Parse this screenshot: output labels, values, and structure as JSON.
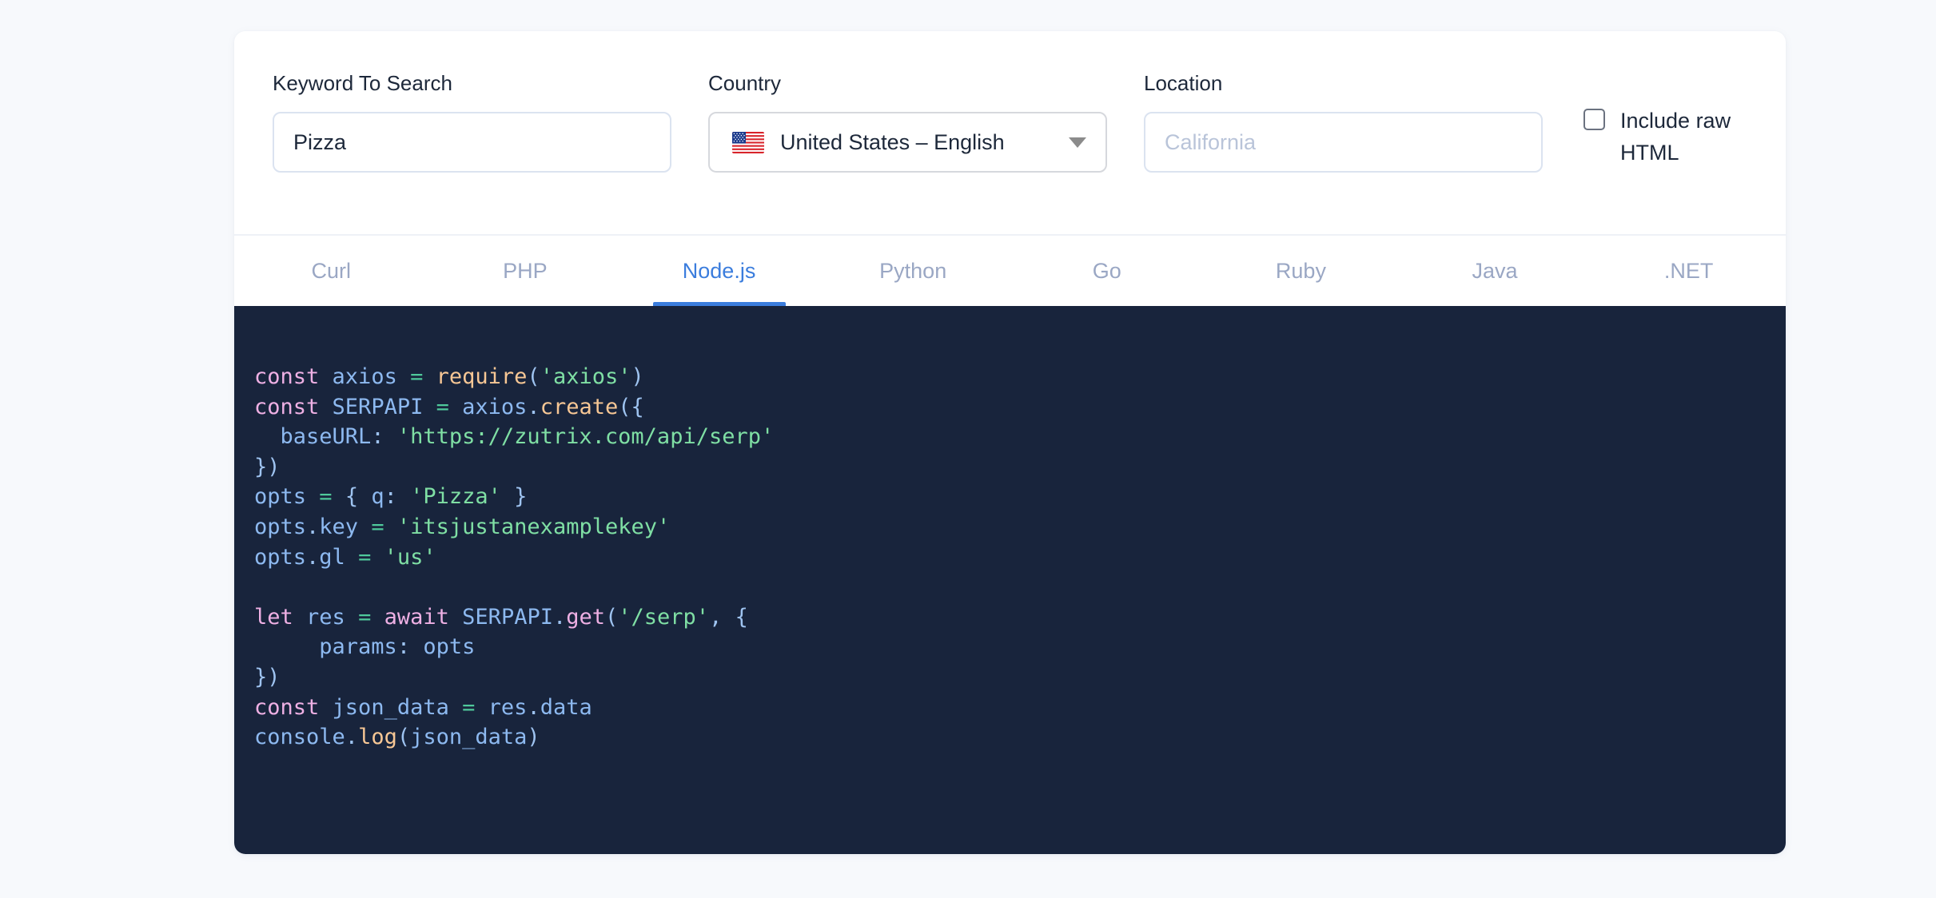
{
  "form": {
    "keyword": {
      "label": "Keyword To Search",
      "value": "Pizza",
      "placeholder": ""
    },
    "country": {
      "label": "Country",
      "value": "United States – English",
      "flag_icon": "us-flag-icon",
      "caret_icon": "chevron-down-icon"
    },
    "location": {
      "label": "Location",
      "value": "",
      "placeholder": "California"
    },
    "raw_html": {
      "label": "Include raw HTML",
      "checked": false
    }
  },
  "tabs": {
    "active": "Node.js",
    "items": [
      {
        "label": "Curl"
      },
      {
        "label": "PHP"
      },
      {
        "label": "Node.js"
      },
      {
        "label": "Python"
      },
      {
        "label": "Go"
      },
      {
        "label": "Ruby"
      },
      {
        "label": "Java"
      },
      {
        "label": ".NET"
      }
    ]
  },
  "code": {
    "language": "Node.js",
    "lines": [
      [
        {
          "t": "const",
          "c": "kw"
        },
        {
          "t": " ",
          "c": "pun"
        },
        {
          "t": "axios",
          "c": "var"
        },
        {
          "t": " ",
          "c": "pun"
        },
        {
          "t": "=",
          "c": "op"
        },
        {
          "t": " ",
          "c": "pun"
        },
        {
          "t": "require",
          "c": "fn"
        },
        {
          "t": "(",
          "c": "pun"
        },
        {
          "t": "'axios'",
          "c": "str"
        },
        {
          "t": ")",
          "c": "pun"
        }
      ],
      [
        {
          "t": "const",
          "c": "kw"
        },
        {
          "t": " ",
          "c": "pun"
        },
        {
          "t": "SERPAPI",
          "c": "var"
        },
        {
          "t": " ",
          "c": "pun"
        },
        {
          "t": "=",
          "c": "op"
        },
        {
          "t": " ",
          "c": "pun"
        },
        {
          "t": "axios",
          "c": "var"
        },
        {
          "t": ".",
          "c": "pun"
        },
        {
          "t": "create",
          "c": "fn"
        },
        {
          "t": "({",
          "c": "pun"
        }
      ],
      [
        {
          "t": "  baseURL",
          "c": "var"
        },
        {
          "t": ": ",
          "c": "pun"
        },
        {
          "t": "'https://zutrix.com/api/serp'",
          "c": "str"
        }
      ],
      [
        {
          "t": "})",
          "c": "pun"
        }
      ],
      [
        {
          "t": "opts",
          "c": "var"
        },
        {
          "t": " ",
          "c": "pun"
        },
        {
          "t": "=",
          "c": "op"
        },
        {
          "t": " ",
          "c": "pun"
        },
        {
          "t": "{ ",
          "c": "pun"
        },
        {
          "t": "q",
          "c": "var"
        },
        {
          "t": ": ",
          "c": "pun"
        },
        {
          "t": "'Pizza'",
          "c": "str"
        },
        {
          "t": " }",
          "c": "pun"
        }
      ],
      [
        {
          "t": "opts",
          "c": "var"
        },
        {
          "t": ".",
          "c": "pun"
        },
        {
          "t": "key",
          "c": "var"
        },
        {
          "t": " ",
          "c": "pun"
        },
        {
          "t": "=",
          "c": "op"
        },
        {
          "t": " ",
          "c": "pun"
        },
        {
          "t": "'itsjustanexamplekey'",
          "c": "str"
        }
      ],
      [
        {
          "t": "opts",
          "c": "var"
        },
        {
          "t": ".",
          "c": "pun"
        },
        {
          "t": "gl",
          "c": "var"
        },
        {
          "t": " ",
          "c": "pun"
        },
        {
          "t": "=",
          "c": "op"
        },
        {
          "t": " ",
          "c": "pun"
        },
        {
          "t": "'us'",
          "c": "str"
        }
      ],
      [],
      [
        {
          "t": "let",
          "c": "kw"
        },
        {
          "t": " ",
          "c": "pun"
        },
        {
          "t": "res",
          "c": "var"
        },
        {
          "t": " ",
          "c": "pun"
        },
        {
          "t": "=",
          "c": "op"
        },
        {
          "t": " ",
          "c": "pun"
        },
        {
          "t": "await",
          "c": "kw"
        },
        {
          "t": " ",
          "c": "pun"
        },
        {
          "t": "SERPAPI",
          "c": "var"
        },
        {
          "t": ".",
          "c": "pun"
        },
        {
          "t": "get",
          "c": "kw"
        },
        {
          "t": "(",
          "c": "pun"
        },
        {
          "t": "'/serp'",
          "c": "str"
        },
        {
          "t": ", {",
          "c": "pun"
        }
      ],
      [
        {
          "t": "     params",
          "c": "var"
        },
        {
          "t": ": ",
          "c": "pun"
        },
        {
          "t": "opts",
          "c": "var"
        }
      ],
      [
        {
          "t": "})",
          "c": "pun"
        }
      ],
      [
        {
          "t": "const",
          "c": "kw"
        },
        {
          "t": " ",
          "c": "pun"
        },
        {
          "t": "json_data",
          "c": "var"
        },
        {
          "t": " ",
          "c": "pun"
        },
        {
          "t": "=",
          "c": "op"
        },
        {
          "t": " ",
          "c": "pun"
        },
        {
          "t": "res",
          "c": "var"
        },
        {
          "t": ".",
          "c": "pun"
        },
        {
          "t": "data",
          "c": "var"
        }
      ],
      [
        {
          "t": "console",
          "c": "var"
        },
        {
          "t": ".",
          "c": "pun"
        },
        {
          "t": "log",
          "c": "fn"
        },
        {
          "t": "(",
          "c": "pun"
        },
        {
          "t": "json_data",
          "c": "var"
        },
        {
          "t": ")",
          "c": "pun"
        }
      ]
    ]
  },
  "colors": {
    "page_background": "#f7f9fc",
    "card_background": "#ffffff",
    "accent": "#3b7ddd",
    "code_background": "#18243c",
    "text": "#1d283a",
    "muted": "#9aa7c4"
  }
}
